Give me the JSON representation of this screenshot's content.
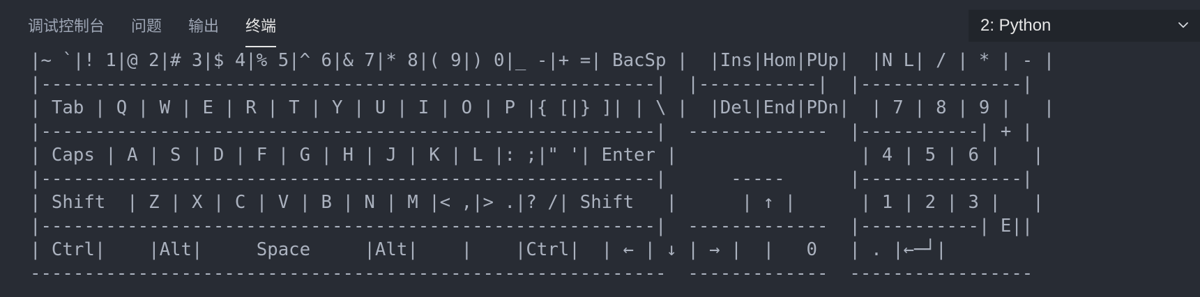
{
  "tabs": [
    {
      "label": "调试控制台",
      "active": false
    },
    {
      "label": "问题",
      "active": false
    },
    {
      "label": "输出",
      "active": false
    },
    {
      "label": "终端",
      "active": true
    }
  ],
  "terminal_select": {
    "value": "2: Python",
    "icon": "chevron-down-icon"
  },
  "terminal": {
    "lines": [
      "|~ `|! 1|@ 2|# 3|$ 4|% 5|^ 6|& 7|* 8|( 9|) 0|_ -|+ =| BacSp |  |Ins|Hom|PUp|  |N L| / | * | - |",
      "|---------------------------------------------------------|  |-----------|  |---------------|",
      "| Tab | Q | W | E | R | T | Y | U | I | O | P |{ [|} ]| | \\ |  |Del|End|PDn|  | 7 | 8 | 9 |   |",
      "|---------------------------------------------------------|  -------------  |-----------| + |",
      "| Caps | A | S | D | F | G | H | J | K | L |: ;|\" '| Enter |                 | 4 | 5 | 6 |   |",
      "|---------------------------------------------------------|      -----      |---------------|",
      "| Shift  | Z | X | C | V | B | N | M |< ,|> .|? /| Shift   |      | ↑ |      | 1 | 2 | 3 |   |",
      "|---------------------------------------------------------|  -------------  |-----------| E||",
      "| Ctrl|    |Alt|     Space     |Alt|    |    |Ctrl|  | ← | ↓ | → |  |   0   | . |←─┘|",
      "-----------------------------------------------------------  -------------  -----------------"
    ]
  }
}
